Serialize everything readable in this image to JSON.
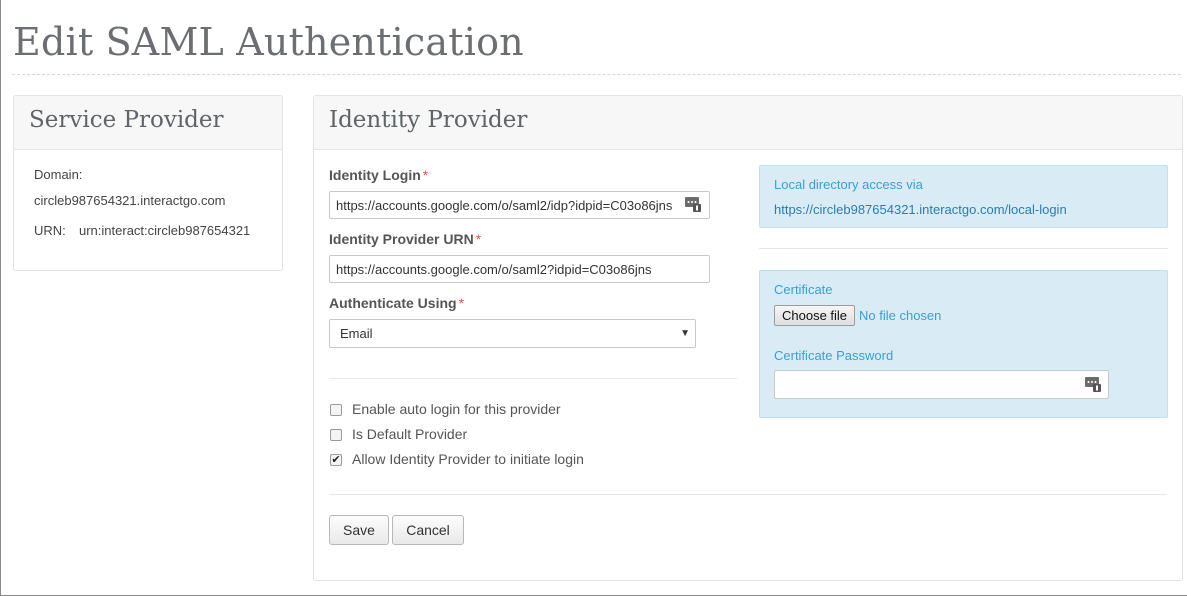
{
  "page": {
    "title": "Edit SAML Authentication"
  },
  "service_provider": {
    "heading": "Service Provider",
    "domain_label": "Domain:",
    "domain_value": "circleb987654321.interactgo.com",
    "urn_label": "URN:",
    "urn_value": "urn:interact:circleb987654321"
  },
  "identity_provider": {
    "heading": "Identity Provider",
    "identity_login": {
      "label": "Identity Login",
      "required_mark": "*",
      "value": "https://accounts.google.com/o/saml2/idp?idpid=C03o86jns"
    },
    "provider_urn": {
      "label": "Identity Provider URN",
      "required_mark": "*",
      "value": "https://accounts.google.com/o/saml2?idpid=C03o86jns"
    },
    "authenticate_using": {
      "label": "Authenticate Using",
      "required_mark": "*",
      "selected": "Email"
    },
    "options": [
      {
        "label": "Enable auto login for this provider",
        "checked": false
      },
      {
        "label": "Is Default Provider",
        "checked": false
      },
      {
        "label": "Allow Identity Provider to initiate login",
        "checked": true
      }
    ],
    "check_mark": "✔",
    "buttons": {
      "save": "Save",
      "cancel": "Cancel"
    }
  },
  "local_directory": {
    "label": "Local directory access via",
    "link": "https://circleb987654321.interactgo.com/local-login"
  },
  "certificate": {
    "label": "Certificate",
    "choose_button": "Choose file",
    "file_status": "No file chosen",
    "password_label": "Certificate Password",
    "password_value": ""
  },
  "icons": {
    "password_manager": "password-manager-key-icon",
    "dropdown": "caret-down-icon"
  },
  "colors": {
    "required": "#d9534f",
    "info_background": "#d9ecf6",
    "info_text": "#3a9fd0",
    "link": "#2a7cb0"
  }
}
